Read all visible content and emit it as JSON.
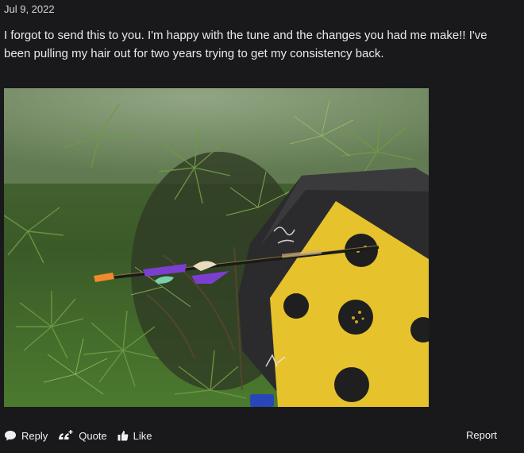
{
  "post": {
    "date": "Jul 9, 2022",
    "body": "I forgot to send this to you. I'm happy with the tune and the changes you had me make!! I've been pulling my hair out for two years trying to get my consistency back.",
    "attachment": {
      "description_icon": "photo-attachment",
      "target_marks": [
        "ꝏ",
        "7K"
      ]
    }
  },
  "actions": {
    "reply_label": "Reply",
    "quote_label": "Quote",
    "like_label": "Like",
    "report_label": "Report"
  },
  "colors": {
    "background": "#19191b",
    "text": "#eaeaea",
    "target_face": "#e6c22c",
    "target_foam": "#2b2b2d",
    "arrow_nock": "#f08a2c",
    "arrow_vane": "#7b3fd0"
  }
}
